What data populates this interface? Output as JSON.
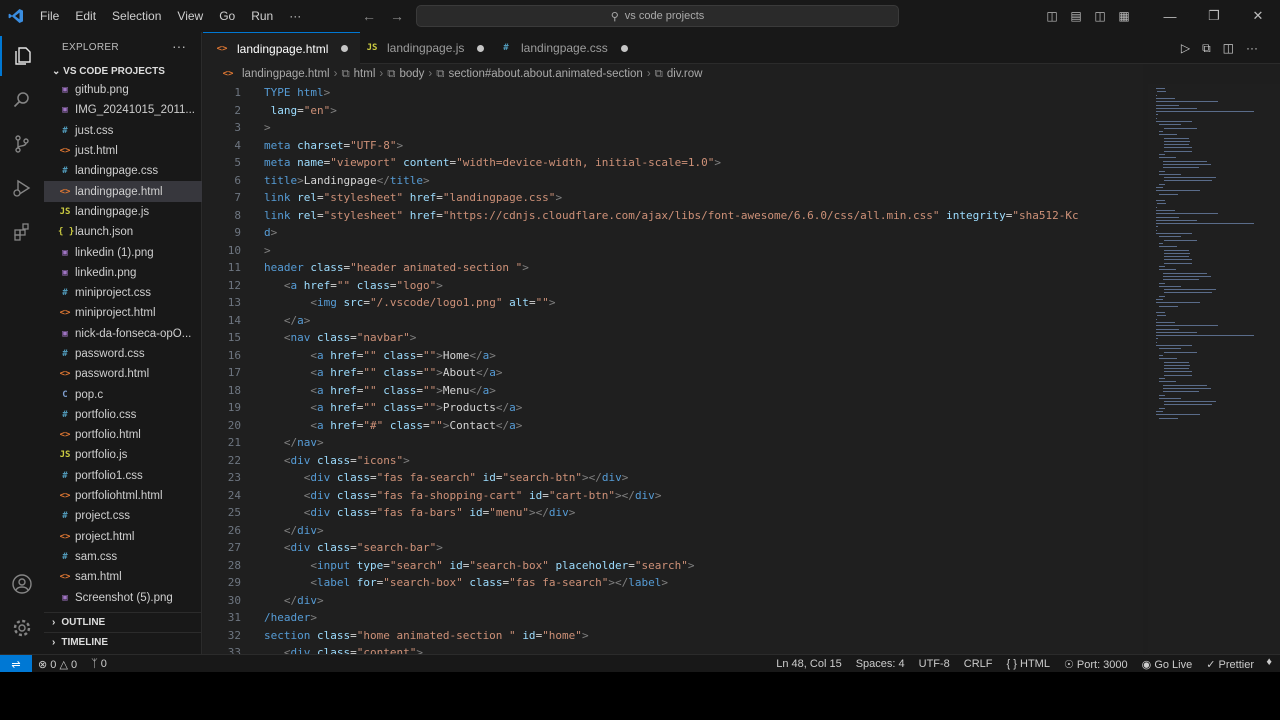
{
  "titlebar": {
    "menu": [
      "File",
      "Edit",
      "Selection",
      "View",
      "Go",
      "Run",
      "···"
    ],
    "search_text": "vs code projects"
  },
  "sidebar": {
    "title": "EXPLORER",
    "project": "VS CODE PROJECTS",
    "files": [
      {
        "name": "github.png",
        "icon": "img"
      },
      {
        "name": "IMG_20241015_2011...",
        "icon": "img"
      },
      {
        "name": "just.css",
        "icon": "css"
      },
      {
        "name": "just.html",
        "icon": "html"
      },
      {
        "name": "landingpage.css",
        "icon": "css"
      },
      {
        "name": "landingpage.html",
        "icon": "html",
        "selected": true
      },
      {
        "name": "landingpage.js",
        "icon": "js"
      },
      {
        "name": "launch.json",
        "icon": "json"
      },
      {
        "name": "linkedin (1).png",
        "icon": "img"
      },
      {
        "name": "linkedin.png",
        "icon": "img"
      },
      {
        "name": "miniproject.css",
        "icon": "css"
      },
      {
        "name": "miniproject.html",
        "icon": "html"
      },
      {
        "name": "nick-da-fonseca-opO...",
        "icon": "img"
      },
      {
        "name": "password.css",
        "icon": "css"
      },
      {
        "name": "password.html",
        "icon": "html"
      },
      {
        "name": "pop.c",
        "icon": "c"
      },
      {
        "name": "portfolio.css",
        "icon": "css"
      },
      {
        "name": "portfolio.html",
        "icon": "html"
      },
      {
        "name": "portfolio.js",
        "icon": "js"
      },
      {
        "name": "portfolio1.css",
        "icon": "css"
      },
      {
        "name": "portfoliohtml.html",
        "icon": "html"
      },
      {
        "name": "project.css",
        "icon": "css"
      },
      {
        "name": "project.html",
        "icon": "html"
      },
      {
        "name": "sam.css",
        "icon": "css"
      },
      {
        "name": "sam.html",
        "icon": "html"
      },
      {
        "name": "Screenshot (5).png",
        "icon": "img"
      }
    ],
    "outline": "OUTLINE",
    "timeline": "TIMELINE"
  },
  "tabs": [
    {
      "label": "landingpage.html",
      "icon": "html",
      "active": true
    },
    {
      "label": "landingpage.js",
      "icon": "js",
      "active": false
    },
    {
      "label": "landingpage.css",
      "icon": "css",
      "active": false
    }
  ],
  "breadcrumb": [
    "landingpage.html",
    "html",
    "body",
    "section#about.about.animated-section",
    "div.row"
  ],
  "editor": {
    "lines": [
      [
        [
          "t",
          "TYPE html"
        ],
        [
          "br",
          ">"
        ]
      ],
      [
        [
          "a",
          " lang"
        ],
        [
          "tx",
          "="
        ],
        [
          "s",
          "\"en\""
        ],
        [
          "br",
          ">"
        ]
      ],
      [
        [
          "br",
          ">"
        ]
      ],
      [
        [
          "t",
          "meta "
        ],
        [
          "a",
          "charset"
        ],
        [
          "tx",
          "="
        ],
        [
          "s",
          "\"UTF-8\""
        ],
        [
          "br",
          ">"
        ]
      ],
      [
        [
          "t",
          "meta "
        ],
        [
          "a",
          "name"
        ],
        [
          "tx",
          "="
        ],
        [
          "s",
          "\"viewport\" "
        ],
        [
          "a",
          "content"
        ],
        [
          "tx",
          "="
        ],
        [
          "s",
          "\"width=device-width, initial-scale=1.0\""
        ],
        [
          "br",
          ">"
        ]
      ],
      [
        [
          "t",
          "title"
        ],
        [
          "br",
          ">"
        ],
        [
          "tx",
          "Landingpage"
        ],
        [
          "br",
          "</"
        ],
        [
          "t",
          "title"
        ],
        [
          "br",
          ">"
        ]
      ],
      [
        [
          "t",
          "link "
        ],
        [
          "a",
          "rel"
        ],
        [
          "tx",
          "="
        ],
        [
          "s",
          "\"stylesheet\" "
        ],
        [
          "a",
          "href"
        ],
        [
          "tx",
          "="
        ],
        [
          "s",
          "\"landingpage.css\""
        ],
        [
          "br",
          ">"
        ]
      ],
      [
        [
          "t",
          "link "
        ],
        [
          "a",
          "rel"
        ],
        [
          "tx",
          "="
        ],
        [
          "s",
          "\"stylesheet\" "
        ],
        [
          "a",
          "href"
        ],
        [
          "tx",
          "="
        ],
        [
          "s",
          "\"https://cdnjs.cloudflare.com/ajax/libs/font-awesome/6.6.0/css/all.min.css\" "
        ],
        [
          "a",
          "integrity"
        ],
        [
          "tx",
          "="
        ],
        [
          "s",
          "\"sha512-Kc"
        ]
      ],
      [
        [
          "t",
          "d"
        ],
        [
          "br",
          ">"
        ]
      ],
      [
        [
          "br",
          ">"
        ]
      ],
      [
        [
          "t",
          "header "
        ],
        [
          "a",
          "class"
        ],
        [
          "tx",
          "="
        ],
        [
          "s",
          "\"header animated-section \""
        ],
        [
          "br",
          ">"
        ]
      ],
      [
        [
          "tx",
          "   "
        ],
        [
          "br",
          "<"
        ],
        [
          "t",
          "a "
        ],
        [
          "a",
          "href"
        ],
        [
          "tx",
          "="
        ],
        [
          "s",
          "\"\" "
        ],
        [
          "a",
          "class"
        ],
        [
          "tx",
          "="
        ],
        [
          "s",
          "\"logo\""
        ],
        [
          "br",
          ">"
        ]
      ],
      [
        [
          "tx",
          "       "
        ],
        [
          "br",
          "<"
        ],
        [
          "t",
          "img "
        ],
        [
          "a",
          "src"
        ],
        [
          "tx",
          "="
        ],
        [
          "s",
          "\"/.vscode/logo1.png\" "
        ],
        [
          "a",
          "alt"
        ],
        [
          "tx",
          "="
        ],
        [
          "s",
          "\"\""
        ],
        [
          "br",
          ">"
        ]
      ],
      [
        [
          "tx",
          "   "
        ],
        [
          "br",
          "</"
        ],
        [
          "t",
          "a"
        ],
        [
          "br",
          ">"
        ]
      ],
      [
        [
          "tx",
          "   "
        ],
        [
          "br",
          "<"
        ],
        [
          "t",
          "nav "
        ],
        [
          "a",
          "class"
        ],
        [
          "tx",
          "="
        ],
        [
          "s",
          "\"navbar\""
        ],
        [
          "br",
          ">"
        ]
      ],
      [
        [
          "tx",
          "       "
        ],
        [
          "br",
          "<"
        ],
        [
          "t",
          "a "
        ],
        [
          "a",
          "href"
        ],
        [
          "tx",
          "="
        ],
        [
          "s",
          "\"\" "
        ],
        [
          "a",
          "class"
        ],
        [
          "tx",
          "="
        ],
        [
          "s",
          "\"\""
        ],
        [
          "br",
          ">"
        ],
        [
          "tx",
          "Home"
        ],
        [
          "br",
          "</"
        ],
        [
          "t",
          "a"
        ],
        [
          "br",
          ">"
        ]
      ],
      [
        [
          "tx",
          "       "
        ],
        [
          "br",
          "<"
        ],
        [
          "t",
          "a "
        ],
        [
          "a",
          "href"
        ],
        [
          "tx",
          "="
        ],
        [
          "s",
          "\"\" "
        ],
        [
          "a",
          "class"
        ],
        [
          "tx",
          "="
        ],
        [
          "s",
          "\"\""
        ],
        [
          "br",
          ">"
        ],
        [
          "tx",
          "About"
        ],
        [
          "br",
          "</"
        ],
        [
          "t",
          "a"
        ],
        [
          "br",
          ">"
        ]
      ],
      [
        [
          "tx",
          "       "
        ],
        [
          "br",
          "<"
        ],
        [
          "t",
          "a "
        ],
        [
          "a",
          "href"
        ],
        [
          "tx",
          "="
        ],
        [
          "s",
          "\"\" "
        ],
        [
          "a",
          "class"
        ],
        [
          "tx",
          "="
        ],
        [
          "s",
          "\"\""
        ],
        [
          "br",
          ">"
        ],
        [
          "tx",
          "Menu"
        ],
        [
          "br",
          "</"
        ],
        [
          "t",
          "a"
        ],
        [
          "br",
          ">"
        ]
      ],
      [
        [
          "tx",
          "       "
        ],
        [
          "br",
          "<"
        ],
        [
          "t",
          "a "
        ],
        [
          "a",
          "href"
        ],
        [
          "tx",
          "="
        ],
        [
          "s",
          "\"\" "
        ],
        [
          "a",
          "class"
        ],
        [
          "tx",
          "="
        ],
        [
          "s",
          "\"\""
        ],
        [
          "br",
          ">"
        ],
        [
          "tx",
          "Products"
        ],
        [
          "br",
          "</"
        ],
        [
          "t",
          "a"
        ],
        [
          "br",
          ">"
        ]
      ],
      [
        [
          "tx",
          "       "
        ],
        [
          "br",
          "<"
        ],
        [
          "t",
          "a "
        ],
        [
          "a",
          "href"
        ],
        [
          "tx",
          "="
        ],
        [
          "s",
          "\"#\" "
        ],
        [
          "a",
          "class"
        ],
        [
          "tx",
          "="
        ],
        [
          "s",
          "\"\""
        ],
        [
          "br",
          ">"
        ],
        [
          "tx",
          "Contact"
        ],
        [
          "br",
          "</"
        ],
        [
          "t",
          "a"
        ],
        [
          "br",
          ">"
        ]
      ],
      [
        [
          "tx",
          "   "
        ],
        [
          "br",
          "</"
        ],
        [
          "t",
          "nav"
        ],
        [
          "br",
          ">"
        ]
      ],
      [
        [
          "tx",
          "   "
        ],
        [
          "br",
          "<"
        ],
        [
          "t",
          "div "
        ],
        [
          "a",
          "class"
        ],
        [
          "tx",
          "="
        ],
        [
          "s",
          "\"icons\""
        ],
        [
          "br",
          ">"
        ]
      ],
      [
        [
          "tx",
          "      "
        ],
        [
          "br",
          "<"
        ],
        [
          "t",
          "div "
        ],
        [
          "a",
          "class"
        ],
        [
          "tx",
          "="
        ],
        [
          "s",
          "\"fas fa-search\" "
        ],
        [
          "a",
          "id"
        ],
        [
          "tx",
          "="
        ],
        [
          "s",
          "\"search-btn\""
        ],
        [
          "br",
          "></"
        ],
        [
          "t",
          "div"
        ],
        [
          "br",
          ">"
        ]
      ],
      [
        [
          "tx",
          "      "
        ],
        [
          "br",
          "<"
        ],
        [
          "t",
          "div "
        ],
        [
          "a",
          "class"
        ],
        [
          "tx",
          "="
        ],
        [
          "s",
          "\"fas fa-shopping-cart\" "
        ],
        [
          "a",
          "id"
        ],
        [
          "tx",
          "="
        ],
        [
          "s",
          "\"cart-btn\""
        ],
        [
          "br",
          "></"
        ],
        [
          "t",
          "div"
        ],
        [
          "br",
          ">"
        ]
      ],
      [
        [
          "tx",
          "      "
        ],
        [
          "br",
          "<"
        ],
        [
          "t",
          "div "
        ],
        [
          "a",
          "class"
        ],
        [
          "tx",
          "="
        ],
        [
          "s",
          "\"fas fa-bars\" "
        ],
        [
          "a",
          "id"
        ],
        [
          "tx",
          "="
        ],
        [
          "s",
          "\"menu\""
        ],
        [
          "br",
          "></"
        ],
        [
          "t",
          "div"
        ],
        [
          "br",
          ">"
        ]
      ],
      [
        [
          "tx",
          "   "
        ],
        [
          "br",
          "</"
        ],
        [
          "t",
          "div"
        ],
        [
          "br",
          ">"
        ]
      ],
      [
        [
          "tx",
          "   "
        ],
        [
          "br",
          "<"
        ],
        [
          "t",
          "div "
        ],
        [
          "a",
          "class"
        ],
        [
          "tx",
          "="
        ],
        [
          "s",
          "\"search-bar\""
        ],
        [
          "br",
          ">"
        ]
      ],
      [
        [
          "tx",
          "       "
        ],
        [
          "br",
          "<"
        ],
        [
          "t",
          "input "
        ],
        [
          "a",
          "type"
        ],
        [
          "tx",
          "="
        ],
        [
          "s",
          "\"search\" "
        ],
        [
          "a",
          "id"
        ],
        [
          "tx",
          "="
        ],
        [
          "s",
          "\"search-box\" "
        ],
        [
          "a",
          "placeholder"
        ],
        [
          "tx",
          "="
        ],
        [
          "s",
          "\"search\""
        ],
        [
          "br",
          ">"
        ]
      ],
      [
        [
          "tx",
          "       "
        ],
        [
          "br",
          "<"
        ],
        [
          "t",
          "label "
        ],
        [
          "a",
          "for"
        ],
        [
          "tx",
          "="
        ],
        [
          "s",
          "\"search-box\" "
        ],
        [
          "a",
          "class"
        ],
        [
          "tx",
          "="
        ],
        [
          "s",
          "\"fas fa-search\""
        ],
        [
          "br",
          "></"
        ],
        [
          "t",
          "label"
        ],
        [
          "br",
          ">"
        ]
      ],
      [
        [
          "tx",
          "   "
        ],
        [
          "br",
          "</"
        ],
        [
          "t",
          "div"
        ],
        [
          "br",
          ">"
        ]
      ],
      [
        [
          "t",
          "/header"
        ],
        [
          "br",
          ">"
        ]
      ],
      [
        [
          "t",
          "section "
        ],
        [
          "a",
          "class"
        ],
        [
          "tx",
          "="
        ],
        [
          "s",
          "\"home animated-section \" "
        ],
        [
          "a",
          "id"
        ],
        [
          "tx",
          "="
        ],
        [
          "s",
          "\"home\""
        ],
        [
          "br",
          ">"
        ]
      ],
      [
        [
          "tx",
          "   "
        ],
        [
          "br",
          "<"
        ],
        [
          "t",
          "div "
        ],
        [
          "a",
          "class"
        ],
        [
          "tx",
          "="
        ],
        [
          "s",
          "\"content\""
        ],
        [
          "br",
          ">"
        ]
      ]
    ]
  },
  "statusbar": {
    "errors": "0",
    "warnings": "0",
    "ports": "0",
    "position": "Ln 48, Col 15",
    "spaces": "Spaces: 4",
    "encoding": "UTF-8",
    "eol": "CRLF",
    "language": "HTML",
    "port": "Port: 3000",
    "golive": "Go Live",
    "prettier": "Prettier"
  },
  "colors": {
    "accent": "#0078d4",
    "background": "#1e1e1e"
  }
}
